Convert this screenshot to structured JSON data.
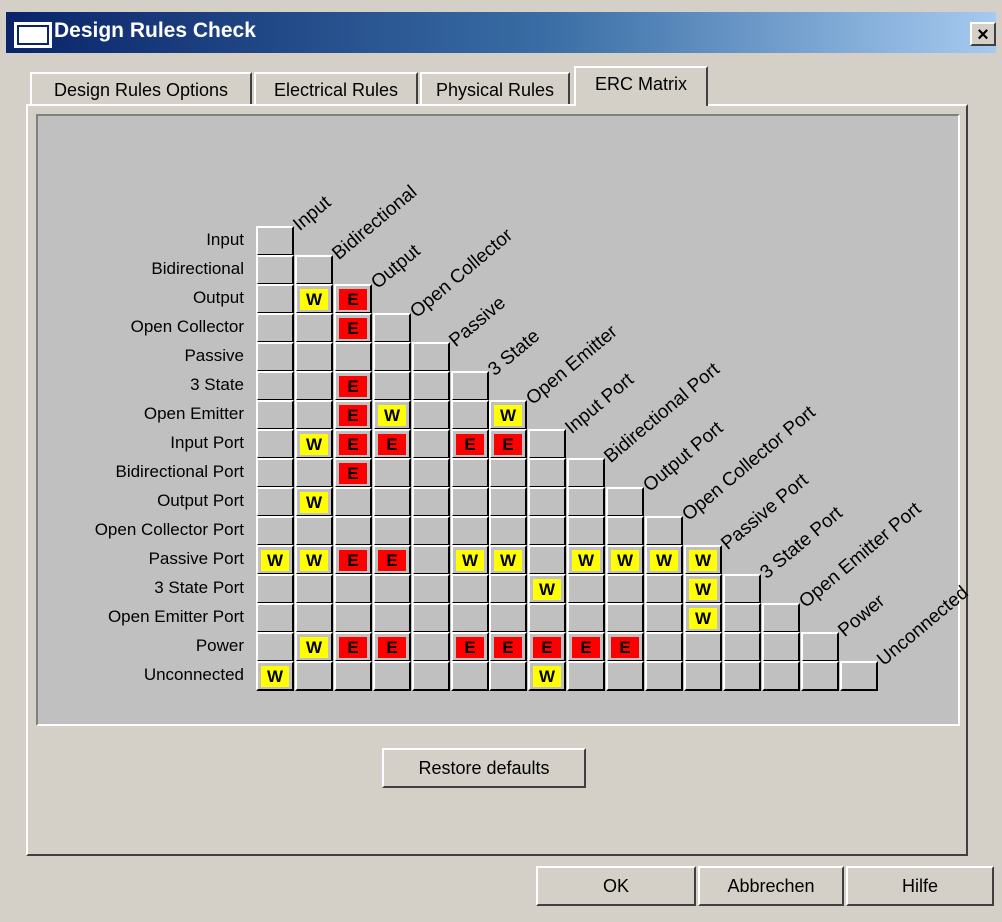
{
  "window": {
    "title": "Design Rules Check",
    "close": "×"
  },
  "tabs": [
    "Design Rules Options",
    "Electrical Rules",
    "Physical Rules",
    "ERC Matrix"
  ],
  "active_tab": "ERC Matrix",
  "matrix": {
    "labels": [
      "Input",
      "Bidirectional",
      "Output",
      "Open Collector",
      "Passive",
      "3 State",
      "Open Emitter",
      "Input Port",
      "Bidirectional Port",
      "Output Port",
      "Open Collector Port",
      "Passive Port",
      "3 State Port",
      "Open Emitter Port",
      "Power",
      "Unconnected"
    ],
    "rows": [
      "",
      "..",
      ".WE",
      "..E.",
      ".....",
      "..E...",
      "..EW..W",
      ".WEE.EE.",
      "..E......",
      ".W........",
      "...........",
      "WWEE.WW.WWWW",
      ".......W...W.",
      "...........W..",
      ".WEE.EEEEE.....",
      "W......W........"
    ],
    "legend": {
      "W": "W",
      "E": "E"
    }
  },
  "buttons": {
    "restore": "Restore defaults",
    "ok": "OK",
    "cancel": "Abbrechen",
    "help": "Hilfe"
  }
}
